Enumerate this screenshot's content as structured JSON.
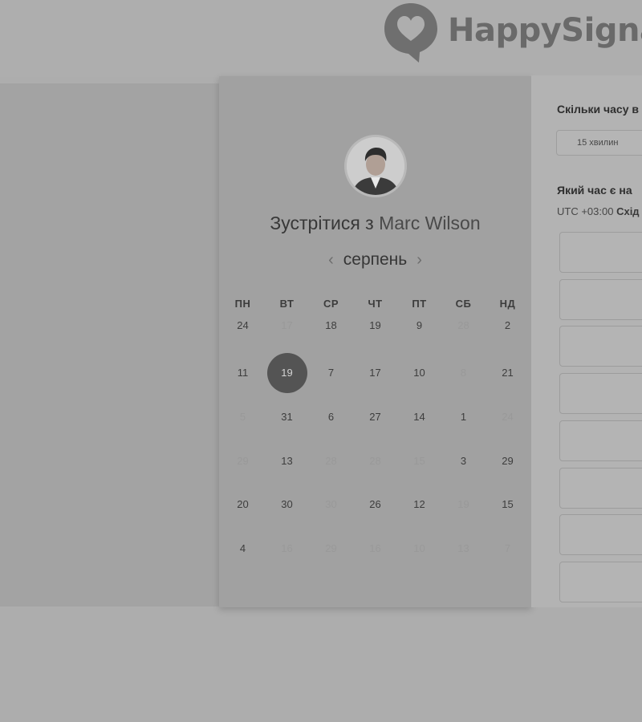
{
  "brand": {
    "name": "HappySigna"
  },
  "calendar": {
    "title_prefix": "Зустрітися з",
    "host_name": "Marc Wilson",
    "month": "серпень",
    "prev_arrow": "‹",
    "next_arrow": "›",
    "weekdays": [
      "ПН",
      "ВТ",
      "СР",
      "ЧТ",
      "ПТ",
      "СБ",
      "НД"
    ],
    "weeks": [
      [
        {
          "d": "24",
          "m": false
        },
        {
          "d": "17",
          "m": true
        },
        {
          "d": "18",
          "m": false
        },
        {
          "d": "19",
          "m": false
        },
        {
          "d": "9",
          "m": false
        },
        {
          "d": "28",
          "m": true
        },
        {
          "d": "2",
          "m": false
        }
      ],
      [
        {
          "d": "11",
          "m": false
        },
        {
          "d": "19",
          "m": false,
          "sel": true
        },
        {
          "d": "7",
          "m": false
        },
        {
          "d": "17",
          "m": false
        },
        {
          "d": "10",
          "m": false
        },
        {
          "d": "8",
          "m": true
        },
        {
          "d": "21",
          "m": false
        }
      ],
      [
        {
          "d": "5",
          "m": true
        },
        {
          "d": "31",
          "m": false
        },
        {
          "d": "6",
          "m": false
        },
        {
          "d": "27",
          "m": false
        },
        {
          "d": "14",
          "m": false
        },
        {
          "d": "1",
          "m": false
        },
        {
          "d": "24",
          "m": true
        }
      ],
      [
        {
          "d": "29",
          "m": true
        },
        {
          "d": "13",
          "m": false
        },
        {
          "d": "28",
          "m": true
        },
        {
          "d": "28",
          "m": true
        },
        {
          "d": "15",
          "m": true
        },
        {
          "d": "3",
          "m": false
        },
        {
          "d": "29",
          "m": false
        }
      ],
      [
        {
          "d": "20",
          "m": false
        },
        {
          "d": "30",
          "m": false
        },
        {
          "d": "30",
          "m": true
        },
        {
          "d": "26",
          "m": false
        },
        {
          "d": "12",
          "m": false
        },
        {
          "d": "19",
          "m": true
        },
        {
          "d": "15",
          "m": false
        }
      ],
      [
        {
          "d": "4",
          "m": false
        },
        {
          "d": "16",
          "m": true
        },
        {
          "d": "29",
          "m": true
        },
        {
          "d": "16",
          "m": true
        },
        {
          "d": "10",
          "m": true
        },
        {
          "d": "13",
          "m": true
        },
        {
          "d": "7",
          "m": true
        }
      ]
    ]
  },
  "scheduler": {
    "duration_question": "Скільки часу в",
    "duration_value": "15 хвилин",
    "time_question": "Який час є на",
    "tz_offset": "UTC +03:00",
    "tz_name": "Схід"
  }
}
